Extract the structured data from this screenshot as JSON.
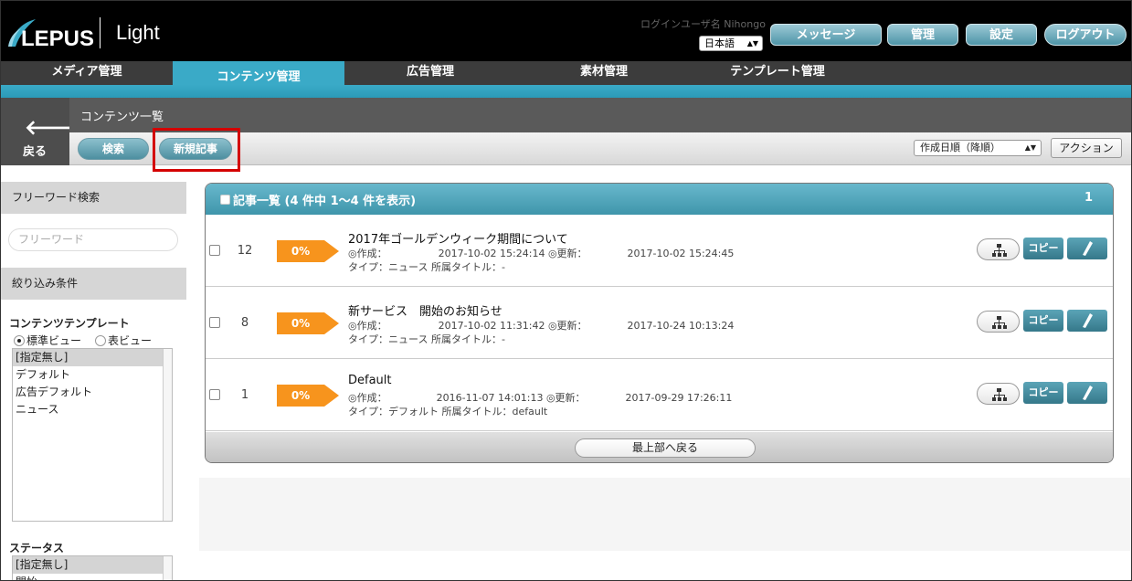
{
  "header": {
    "logo": "LEPUS",
    "product": "Light",
    "user_name": "ログインユーザ名 Nihongo",
    "language": "日本語",
    "buttons": {
      "message": "メッセージ",
      "manage": "管理",
      "settings": "設定",
      "logout": "ログアウト"
    }
  },
  "nav": {
    "items": [
      "メディア管理",
      "コンテンツ管理",
      "広告管理",
      "素材管理",
      "テンプレート管理"
    ],
    "active_index": 1
  },
  "page": {
    "title": "コンテンツ一覧",
    "back_label": "戻る",
    "search_button": "検索",
    "new_article_button": "新規記事",
    "sort_value": "作成日順（降順）",
    "action_button": "アクション"
  },
  "sidebar": {
    "freeword_heading": "フリーワード検索",
    "freeword_placeholder": "フリーワード",
    "filter_heading": "絞り込み条件",
    "template_label": "コンテンツテンプレート",
    "view_standard": "標準ビュー",
    "view_table": "表ビュー",
    "templates": [
      "[指定無し]",
      "デフォルト",
      "広告デフォルト",
      "ニュース"
    ],
    "status_label": "ステータス",
    "statuses": [
      "[指定無し]",
      "開始"
    ]
  },
  "list": {
    "header": "記事一覧 (4 件中 1〜4 件を表示)",
    "page_number": "1",
    "rows": [
      {
        "id": "12",
        "progress": "0%",
        "title": "2017年ゴールデンウィーク期間について",
        "created_label": "◎作成：",
        "created": "2017-10-02 15:24:14",
        "updated_label": "◎更新：",
        "updated": "2017-10-02 15:24:45",
        "type_line": "タイプ：ニュース 所属タイトル：-"
      },
      {
        "id": "8",
        "progress": "0%",
        "title": "新サービス　開始のお知らせ",
        "created_label": "◎作成：",
        "created": "2017-10-02 11:31:42",
        "updated_label": "◎更新：",
        "updated": "2017-10-24 10:13:24",
        "type_line": "タイプ：ニュース 所属タイトル：-"
      },
      {
        "id": "1",
        "progress": "0%",
        "title": "Default",
        "created_label": "◎作成：",
        "created": "2016-11-07 14:01:13",
        "updated_label": "◎更新：",
        "updated": "2017-09-29 17:26:11",
        "type_line": "タイプ：デフォルト 所属タイトル：default"
      }
    ],
    "copy_label": "コピー",
    "back_to_top": "最上部へ戻る"
  },
  "colors": {
    "accent": "#3aaac7",
    "progress": "#f7941d",
    "highlight": "#d40000"
  }
}
